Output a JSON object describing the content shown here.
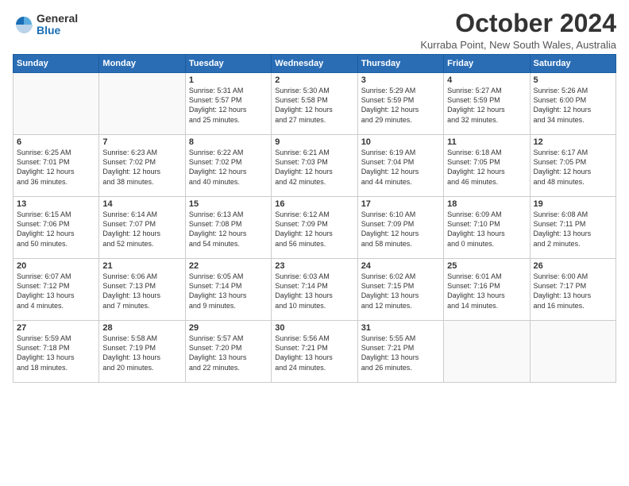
{
  "logo": {
    "general": "General",
    "blue": "Blue"
  },
  "header": {
    "month": "October 2024",
    "location": "Kurraba Point, New South Wales, Australia"
  },
  "days_of_week": [
    "Sunday",
    "Monday",
    "Tuesday",
    "Wednesday",
    "Thursday",
    "Friday",
    "Saturday"
  ],
  "weeks": [
    [
      {
        "day": "",
        "info": ""
      },
      {
        "day": "",
        "info": ""
      },
      {
        "day": "1",
        "info": "Sunrise: 5:31 AM\nSunset: 5:57 PM\nDaylight: 12 hours\nand 25 minutes."
      },
      {
        "day": "2",
        "info": "Sunrise: 5:30 AM\nSunset: 5:58 PM\nDaylight: 12 hours\nand 27 minutes."
      },
      {
        "day": "3",
        "info": "Sunrise: 5:29 AM\nSunset: 5:59 PM\nDaylight: 12 hours\nand 29 minutes."
      },
      {
        "day": "4",
        "info": "Sunrise: 5:27 AM\nSunset: 5:59 PM\nDaylight: 12 hours\nand 32 minutes."
      },
      {
        "day": "5",
        "info": "Sunrise: 5:26 AM\nSunset: 6:00 PM\nDaylight: 12 hours\nand 34 minutes."
      }
    ],
    [
      {
        "day": "6",
        "info": "Sunrise: 6:25 AM\nSunset: 7:01 PM\nDaylight: 12 hours\nand 36 minutes."
      },
      {
        "day": "7",
        "info": "Sunrise: 6:23 AM\nSunset: 7:02 PM\nDaylight: 12 hours\nand 38 minutes."
      },
      {
        "day": "8",
        "info": "Sunrise: 6:22 AM\nSunset: 7:02 PM\nDaylight: 12 hours\nand 40 minutes."
      },
      {
        "day": "9",
        "info": "Sunrise: 6:21 AM\nSunset: 7:03 PM\nDaylight: 12 hours\nand 42 minutes."
      },
      {
        "day": "10",
        "info": "Sunrise: 6:19 AM\nSunset: 7:04 PM\nDaylight: 12 hours\nand 44 minutes."
      },
      {
        "day": "11",
        "info": "Sunrise: 6:18 AM\nSunset: 7:05 PM\nDaylight: 12 hours\nand 46 minutes."
      },
      {
        "day": "12",
        "info": "Sunrise: 6:17 AM\nSunset: 7:05 PM\nDaylight: 12 hours\nand 48 minutes."
      }
    ],
    [
      {
        "day": "13",
        "info": "Sunrise: 6:15 AM\nSunset: 7:06 PM\nDaylight: 12 hours\nand 50 minutes."
      },
      {
        "day": "14",
        "info": "Sunrise: 6:14 AM\nSunset: 7:07 PM\nDaylight: 12 hours\nand 52 minutes."
      },
      {
        "day": "15",
        "info": "Sunrise: 6:13 AM\nSunset: 7:08 PM\nDaylight: 12 hours\nand 54 minutes."
      },
      {
        "day": "16",
        "info": "Sunrise: 6:12 AM\nSunset: 7:09 PM\nDaylight: 12 hours\nand 56 minutes."
      },
      {
        "day": "17",
        "info": "Sunrise: 6:10 AM\nSunset: 7:09 PM\nDaylight: 12 hours\nand 58 minutes."
      },
      {
        "day": "18",
        "info": "Sunrise: 6:09 AM\nSunset: 7:10 PM\nDaylight: 13 hours\nand 0 minutes."
      },
      {
        "day": "19",
        "info": "Sunrise: 6:08 AM\nSunset: 7:11 PM\nDaylight: 13 hours\nand 2 minutes."
      }
    ],
    [
      {
        "day": "20",
        "info": "Sunrise: 6:07 AM\nSunset: 7:12 PM\nDaylight: 13 hours\nand 4 minutes."
      },
      {
        "day": "21",
        "info": "Sunrise: 6:06 AM\nSunset: 7:13 PM\nDaylight: 13 hours\nand 7 minutes."
      },
      {
        "day": "22",
        "info": "Sunrise: 6:05 AM\nSunset: 7:14 PM\nDaylight: 13 hours\nand 9 minutes."
      },
      {
        "day": "23",
        "info": "Sunrise: 6:03 AM\nSunset: 7:14 PM\nDaylight: 13 hours\nand 10 minutes."
      },
      {
        "day": "24",
        "info": "Sunrise: 6:02 AM\nSunset: 7:15 PM\nDaylight: 13 hours\nand 12 minutes."
      },
      {
        "day": "25",
        "info": "Sunrise: 6:01 AM\nSunset: 7:16 PM\nDaylight: 13 hours\nand 14 minutes."
      },
      {
        "day": "26",
        "info": "Sunrise: 6:00 AM\nSunset: 7:17 PM\nDaylight: 13 hours\nand 16 minutes."
      }
    ],
    [
      {
        "day": "27",
        "info": "Sunrise: 5:59 AM\nSunset: 7:18 PM\nDaylight: 13 hours\nand 18 minutes."
      },
      {
        "day": "28",
        "info": "Sunrise: 5:58 AM\nSunset: 7:19 PM\nDaylight: 13 hours\nand 20 minutes."
      },
      {
        "day": "29",
        "info": "Sunrise: 5:57 AM\nSunset: 7:20 PM\nDaylight: 13 hours\nand 22 minutes."
      },
      {
        "day": "30",
        "info": "Sunrise: 5:56 AM\nSunset: 7:21 PM\nDaylight: 13 hours\nand 24 minutes."
      },
      {
        "day": "31",
        "info": "Sunrise: 5:55 AM\nSunset: 7:21 PM\nDaylight: 13 hours\nand 26 minutes."
      },
      {
        "day": "",
        "info": ""
      },
      {
        "day": "",
        "info": ""
      }
    ]
  ]
}
